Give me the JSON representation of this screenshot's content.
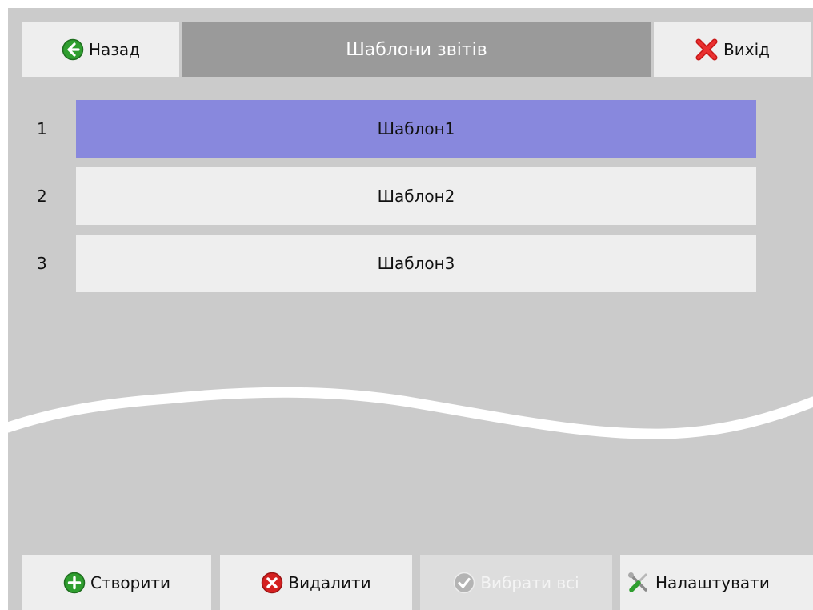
{
  "header": {
    "back_label": "Назад",
    "title": "Шаблони звітів",
    "exit_label": "Вихід"
  },
  "templates": [
    {
      "number": "1",
      "name": "Шаблон1",
      "selected": true
    },
    {
      "number": "2",
      "name": "Шаблон2",
      "selected": false
    },
    {
      "number": "3",
      "name": "Шаблон3",
      "selected": false
    }
  ],
  "footer": {
    "create_label": "Створити",
    "delete_label": "Видалити",
    "select_all_label": "Вибрати всі",
    "select_all_enabled": false,
    "settings_label": "Налаштувати"
  },
  "icons": {
    "back": "arrow-left-circle-icon",
    "exit": "red-x-icon",
    "create": "plus-circle-icon",
    "delete": "x-circle-icon",
    "select_all": "check-circle-icon",
    "settings": "tools-icon"
  },
  "colors": {
    "background": "#cbcbcb",
    "button": "#eeeeee",
    "title_bar": "#9a9a9a",
    "selected_row": "#8888dd",
    "green_icon": "#2f9e2f",
    "red_icon": "#d42020"
  }
}
